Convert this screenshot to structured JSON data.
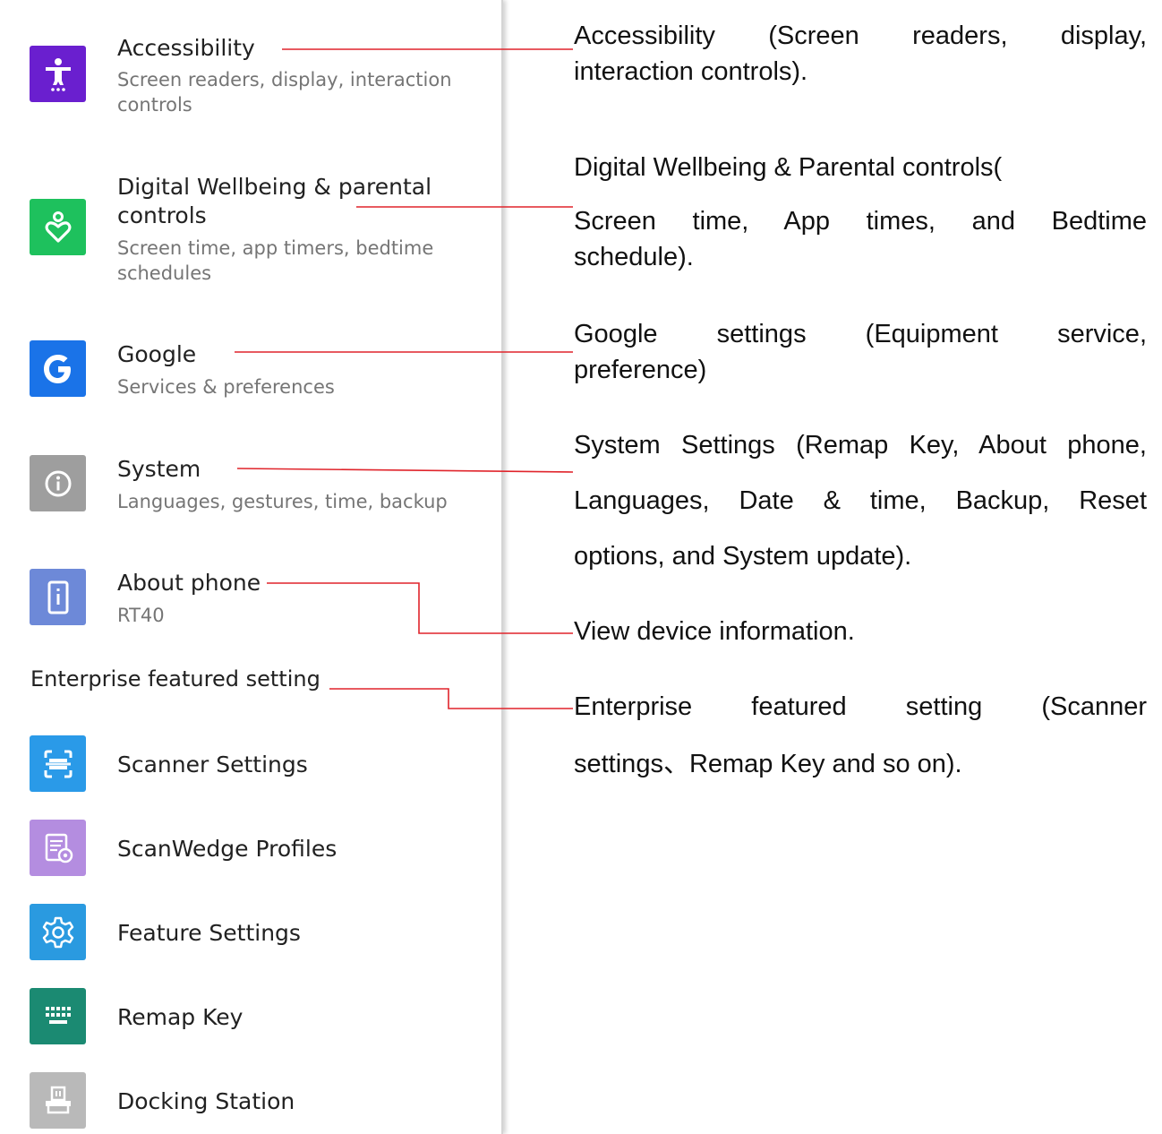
{
  "settings": {
    "accessibility": {
      "title": "Accessibility",
      "subtitle": "Screen readers, display, interaction controls",
      "icon": "accessibility-person-icon",
      "color": "#6a1fcf"
    },
    "wellbeing": {
      "title": "Digital Wellbeing & parental controls",
      "subtitle": "Screen time, app timers, bedtime schedules",
      "icon": "wellbeing-heart-icon",
      "color": "#1ec15d"
    },
    "google": {
      "title": "Google",
      "subtitle": "Services & preferences",
      "icon": "google-g-icon",
      "color": "#1a73e8"
    },
    "system": {
      "title": "System",
      "subtitle": "Languages, gestures, time, backup",
      "icon": "info-circle-icon",
      "color": "#9e9e9e"
    },
    "about": {
      "title": "About phone",
      "subtitle": "RT40",
      "icon": "phone-info-icon",
      "color": "#6d89d8"
    },
    "enterprise_header": "Enterprise featured setting",
    "scanner": {
      "title": "Scanner Settings",
      "icon": "scanner-icon",
      "color": "#2a9ae8"
    },
    "scanwedge": {
      "title": "ScanWedge Profiles",
      "icon": "profile-settings-icon",
      "color": "#b48de0"
    },
    "feature": {
      "title": "Feature Settings",
      "icon": "gear-icon",
      "color": "#2a9ae0"
    },
    "remap": {
      "title": "Remap Key",
      "icon": "keyboard-icon",
      "color": "#1b8a72"
    },
    "docking": {
      "title": "Docking Station",
      "icon": "docking-station-icon",
      "color": "#b9b9b9"
    }
  },
  "annotations": {
    "accessibility": [
      "Accessibility (Screen readers, display,",
      "interaction controls)."
    ],
    "wellbeing": [
      "Digital Wellbeing  &  Parental controls(",
      "Screen time, App times, and Bedtime",
      "schedule)."
    ],
    "google": [
      "Google settings (Equipment service,",
      "preference)"
    ],
    "system": [
      "System Settings (Remap Key, About phone,",
      "Languages, Date  &  time, Backup, Reset",
      "options, and System update)."
    ],
    "about": [
      "View device information."
    ],
    "enterprise": [
      "Enterprise featured setting (Scanner",
      "settings、Remap Key and so on)."
    ]
  },
  "colors": {
    "connector": "#e0242b",
    "title_text": "#212121",
    "subtitle_text": "#757575"
  }
}
